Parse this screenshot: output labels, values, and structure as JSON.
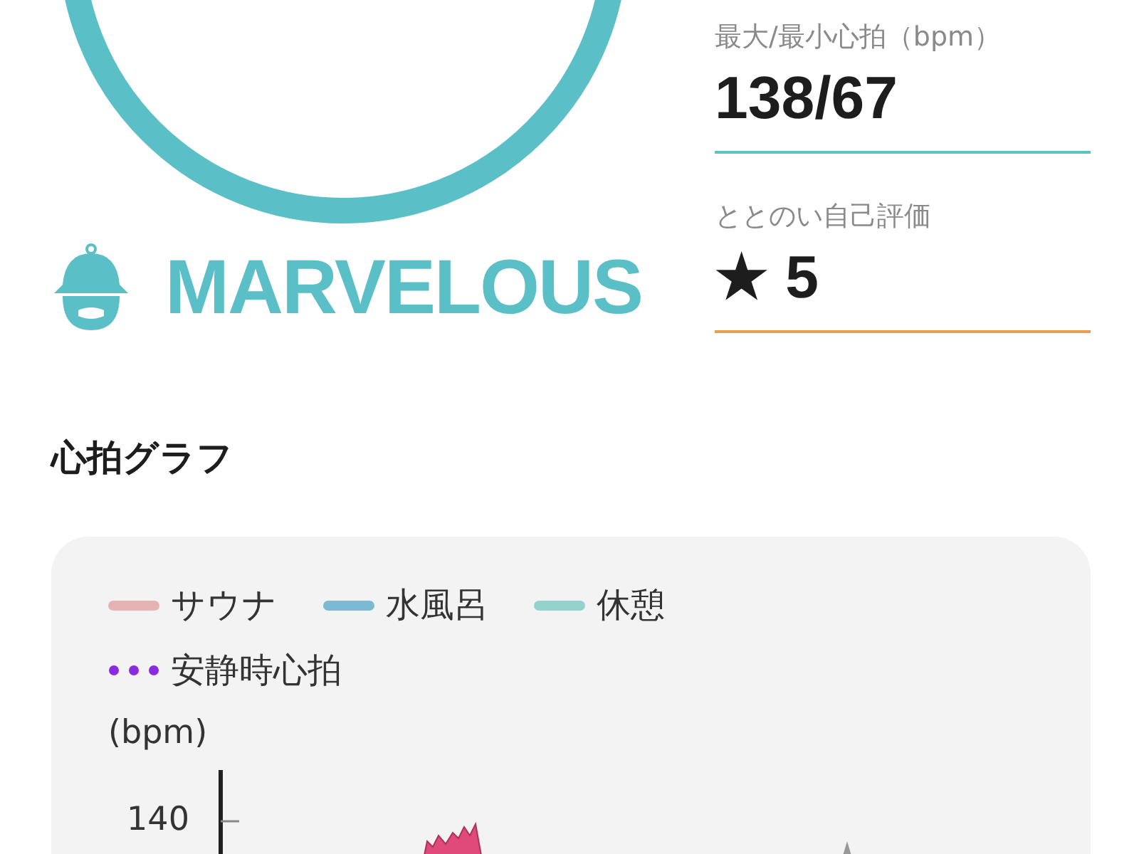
{
  "rating": {
    "label": "MARVELOUS"
  },
  "stats": [
    {
      "label": "最大/最小心拍（bpm）",
      "value": "138/67",
      "color": "#5cc2c4"
    },
    {
      "label": "ととのい自己評価",
      "value": "★ 5",
      "color": "#e8a04c"
    }
  ],
  "section_title": "心拍グラフ",
  "chart": {
    "legend": [
      {
        "label": "サウナ",
        "color": "#e6b3b5",
        "kind": "line"
      },
      {
        "label": "水風呂",
        "color": "#7bbad2",
        "kind": "line"
      },
      {
        "label": "休憩",
        "color": "#93d3cd",
        "kind": "line"
      },
      {
        "label": "安静時心拍",
        "color": "#8a2be2",
        "kind": "dots"
      }
    ],
    "ylabel": "(bpm)",
    "tick": "140"
  }
}
